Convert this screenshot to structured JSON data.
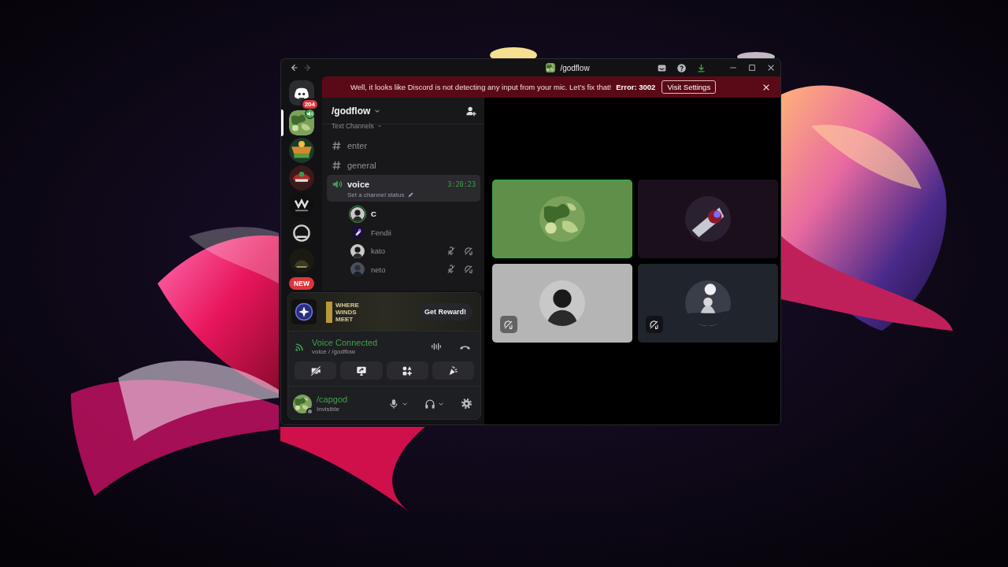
{
  "window": {
    "title": "/godflow"
  },
  "banner": {
    "message": "Well, it looks like Discord is not detecting any input from your mic. Let’s fix that!",
    "error": "Error: 3002",
    "button": "Visit Settings"
  },
  "server_rail": {
    "dm_badge": "204",
    "new_badge": "NEW",
    "servers": [
      {
        "selected": true,
        "in_voice": true
      },
      {
        "selected": false,
        "in_voice": false
      },
      {
        "selected": false,
        "in_voice": false
      },
      {
        "selected": false,
        "in_voice": false
      },
      {
        "selected": false,
        "in_voice": false
      },
      {
        "selected": false,
        "in_voice": false
      }
    ]
  },
  "server": {
    "name": "/godflow"
  },
  "category": {
    "label": "Text Channels"
  },
  "channels": [
    {
      "kind": "text",
      "name": "enter",
      "selected": false
    },
    {
      "kind": "text",
      "name": "general",
      "selected": false
    },
    {
      "kind": "voice",
      "name": "voice",
      "selected": true,
      "timer": "3:20:23",
      "status_placeholder": "Set a channel status"
    }
  ],
  "voice_users": [
    {
      "name": "C",
      "speaking": true,
      "muted": false,
      "deafened": false
    },
    {
      "name": "Fendii",
      "speaking": false,
      "muted": false,
      "deafened": false
    },
    {
      "name": "kato",
      "speaking": false,
      "muted": true,
      "deafened": true
    },
    {
      "name": "neto",
      "speaking": false,
      "muted": true,
      "deafened": true
    }
  ],
  "promo": {
    "game": "WHERE WINDS MEET",
    "button": "Get Reward!"
  },
  "voice_panel": {
    "status": "Voice Connected",
    "location": "voice / /godflow"
  },
  "user": {
    "name": "/capgod",
    "status": "Invisible"
  },
  "tiles": [
    {
      "color": "#5f8f48",
      "speaking": true,
      "deafened": false
    },
    {
      "color": "#1c0f1c",
      "speaking": false,
      "deafened": false
    },
    {
      "color": "#b5b5b5",
      "speaking": false,
      "deafened": true
    },
    {
      "color": "#20242c",
      "speaking": false,
      "deafened": true
    }
  ]
}
